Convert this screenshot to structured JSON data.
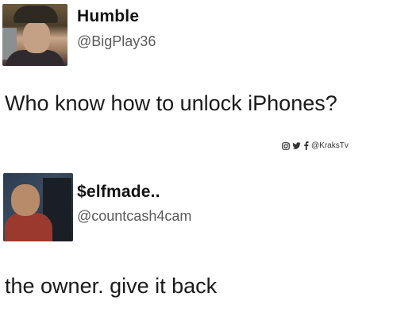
{
  "tweet1": {
    "display_name": "Humble",
    "handle": "@BigPlay36",
    "text": "Who know how to unlock iPhones?"
  },
  "watermark": {
    "icons": [
      "instagram-icon",
      "twitter-icon",
      "facebook-icon"
    ],
    "handle": "@KraksTv"
  },
  "tweet2": {
    "display_name": "$elfmade..",
    "handle": "@countcash4cam",
    "text": "the owner. give it back"
  }
}
